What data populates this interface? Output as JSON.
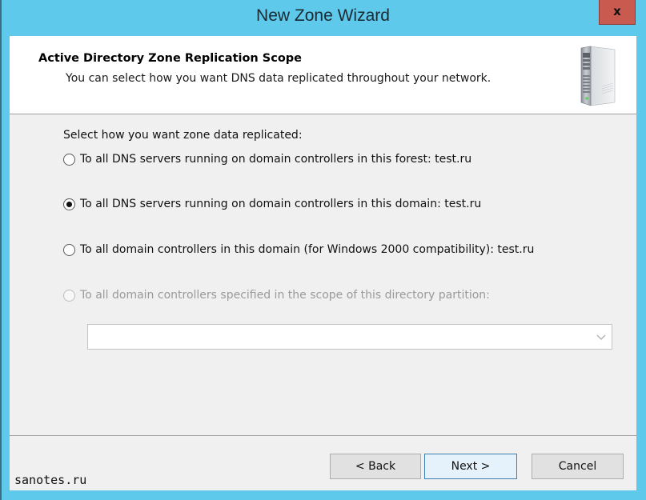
{
  "window": {
    "title": "New Zone Wizard",
    "close_label": "x"
  },
  "header": {
    "title": "Active Directory Zone Replication Scope",
    "subtitle": "You can select how you want DNS data replicated throughout your network.",
    "icon": "server-tower-icon"
  },
  "body": {
    "prompt": "Select how you want zone data replicated:",
    "options": [
      {
        "label": "To all DNS servers running on domain controllers in this forest: test.ru",
        "selected": false,
        "enabled": true
      },
      {
        "label": "To all DNS servers running on domain controllers in this domain: test.ru",
        "selected": true,
        "enabled": true
      },
      {
        "label": "To all domain controllers in this domain (for Windows 2000 compatibility): test.ru",
        "selected": false,
        "enabled": true
      },
      {
        "label": "To all domain controllers specified in the scope of this directory partition:",
        "selected": false,
        "enabled": false
      }
    ],
    "partition_select": {
      "value": "",
      "enabled": false
    }
  },
  "footer": {
    "back_label": "< Back",
    "next_label": "Next >",
    "cancel_label": "Cancel"
  },
  "watermark": "sanotes.ru",
  "colors": {
    "frame": "#5ec9ea",
    "close_button": "#c95a4f",
    "default_button_border": "#3c7fb1"
  }
}
